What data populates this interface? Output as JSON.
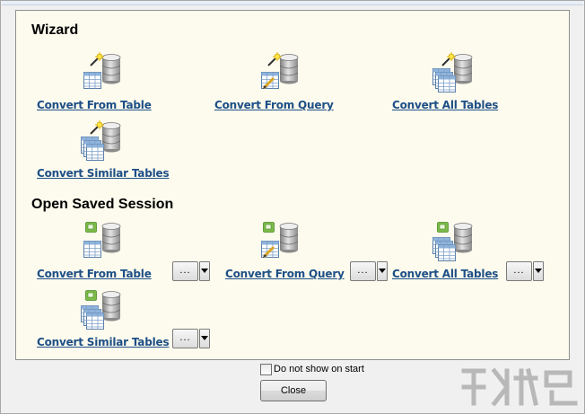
{
  "wizard": {
    "title": "Wizard",
    "items": [
      {
        "label": "Convert From Table",
        "icon": "wizard-table-database-icon"
      },
      {
        "label": "Convert From Query",
        "icon": "wizard-query-database-icon"
      },
      {
        "label": "Convert All Tables",
        "icon": "wizard-all-tables-database-icon"
      },
      {
        "label": "Convert Similar Tables",
        "icon": "wizard-similar-tables-database-icon"
      }
    ]
  },
  "saved": {
    "title": "Open Saved Session",
    "items": [
      {
        "label": "Convert From Table",
        "icon": "session-table-database-icon"
      },
      {
        "label": "Convert From Query",
        "icon": "session-query-database-icon"
      },
      {
        "label": "Convert All Tables",
        "icon": "session-all-tables-database-icon"
      },
      {
        "label": "Convert Similar Tables",
        "icon": "session-similar-tables-database-icon"
      }
    ],
    "picker_label": "..."
  },
  "footer": {
    "checkbox_label": "Do not show on start",
    "checkbox_checked": false,
    "close_label": "Close"
  },
  "colors": {
    "link": "#1e4f86",
    "panel_bg": "#fdfbee",
    "window_bg": "#f0f0f0"
  }
}
